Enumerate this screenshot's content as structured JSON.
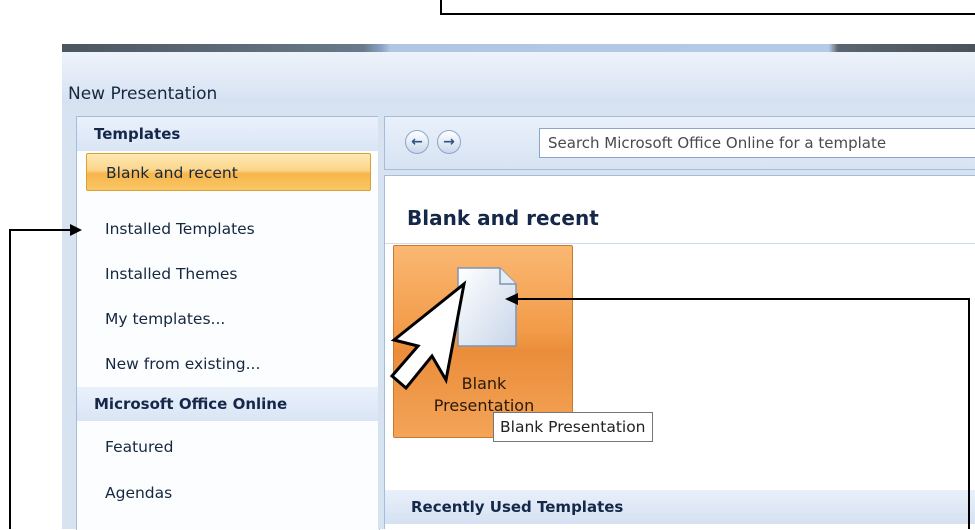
{
  "dialog": {
    "title": "New Presentation"
  },
  "left_pane": {
    "templates_header": "Templates",
    "items": [
      {
        "label": "Blank and recent",
        "selected": true
      },
      {
        "label": "Installed Templates"
      },
      {
        "label": "Installed Themes"
      },
      {
        "label": "My templates..."
      },
      {
        "label": "New from existing..."
      }
    ],
    "online_header": "Microsoft Office Online",
    "online_items": [
      {
        "label": "Featured"
      },
      {
        "label": "Agendas"
      }
    ]
  },
  "nav_bar": {
    "back_icon": "back-arrow-icon",
    "forward_icon": "forward-arrow-icon",
    "search_placeholder": "Search Microsoft Office Online for a template"
  },
  "content": {
    "title": "Blank and recent",
    "tile_label_line1": "Blank",
    "tile_label_line2": "Presentation",
    "tooltip": "Blank Presentation",
    "recent_header": "Recently Used Templates"
  },
  "colors": {
    "selection_orange": "#f8b54b",
    "tile_orange": "#f29b48",
    "header_blue": "#15284a",
    "border_blue": "#a6bcd9"
  }
}
